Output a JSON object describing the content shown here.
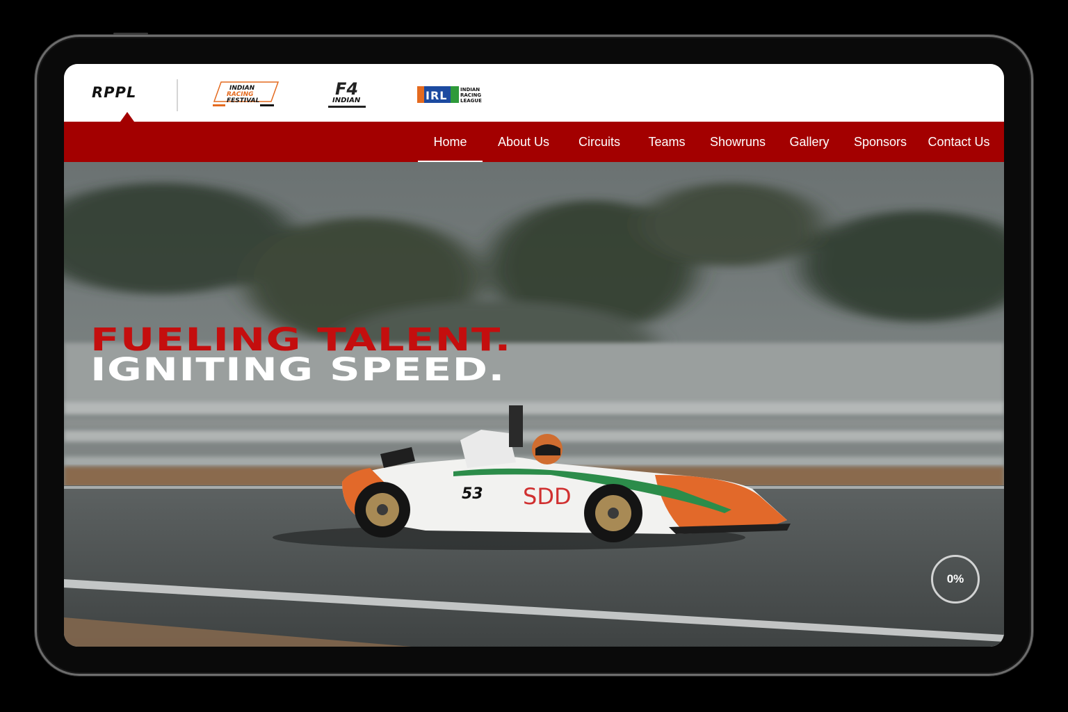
{
  "header": {
    "logos": [
      {
        "name": "RPPL",
        "text": "RPPL"
      },
      {
        "name": "Indian Racing Festival",
        "lines": [
          "INDIAN",
          "RACING",
          "FESTIVAL"
        ]
      },
      {
        "name": "F4 Indian",
        "mark": "F4",
        "sub": "INDIAN"
      },
      {
        "name": "Indian Racing League",
        "mark": "IRL",
        "lines": [
          "INDIAN",
          "RACING",
          "LEAGUE"
        ]
      }
    ]
  },
  "nav": {
    "items": [
      {
        "label": "Home",
        "active": true
      },
      {
        "label": "About Us"
      },
      {
        "label": "Circuits"
      },
      {
        "label": "Teams"
      },
      {
        "label": "Showruns"
      },
      {
        "label": "Gallery"
      },
      {
        "label": "Sponsors"
      },
      {
        "label": "Contact Us"
      }
    ]
  },
  "hero": {
    "headline_line1": "FUELING TALENT.",
    "headline_line2": "IGNITING SPEED.",
    "car_number": "53",
    "car_sponsor": "SDD",
    "progress": "0%"
  },
  "colors": {
    "brand_red": "#a30000",
    "headline_red": "#c40e0e",
    "white": "#ffffff"
  }
}
